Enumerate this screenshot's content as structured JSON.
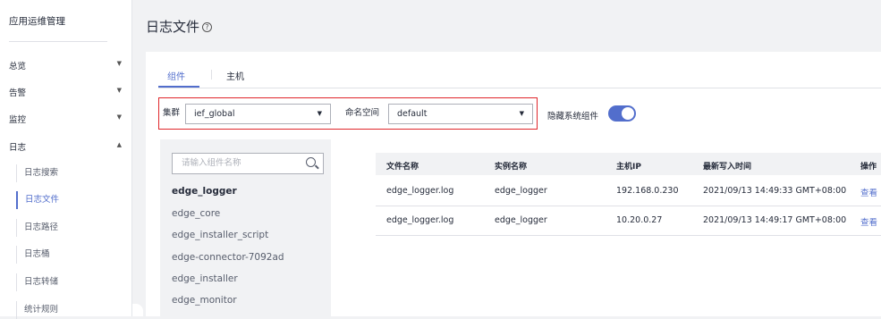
{
  "sidebar": {
    "title": "应用运维管理",
    "groups": [
      {
        "label": "总览",
        "arrow": "▼"
      },
      {
        "label": "告警",
        "arrow": "▼"
      },
      {
        "label": "监控",
        "arrow": "▼"
      },
      {
        "label": "日志",
        "arrow": "▲"
      }
    ],
    "sub_items": [
      {
        "label": "日志搜索",
        "active": false
      },
      {
        "label": "日志文件",
        "active": true
      },
      {
        "label": "日志路径",
        "active": false
      },
      {
        "label": "日志桶",
        "active": false
      },
      {
        "label": "日志转储",
        "active": false
      },
      {
        "label": "统计规则",
        "active": false
      }
    ]
  },
  "header": {
    "title": "日志文件",
    "help_icon": "question-circle-icon"
  },
  "tabs": [
    {
      "label": "组件",
      "active": true
    },
    {
      "label": "主机",
      "active": false
    }
  ],
  "filters": {
    "cluster_label": "集群",
    "cluster_value": "ief_global",
    "namespace_label": "命名空间",
    "namespace_value": "default",
    "hide_system_label": "隐藏系统组件",
    "hide_system_on": true
  },
  "components": {
    "search_placeholder": "请输入组件名称",
    "items": [
      "edge_logger",
      "edge_core",
      "edge_installer_script",
      "edge-connector-7092ad",
      "edge_installer",
      "edge_monitor"
    ],
    "selected": "edge_logger"
  },
  "table": {
    "columns": [
      "文件名称",
      "实例名称",
      "主机IP",
      "最新写入时间",
      "操作"
    ],
    "rows": [
      {
        "file": "edge_logger.log",
        "instance": "edge_logger",
        "ip": "192.168.0.230",
        "time": "2021/09/13 14:49:33 GMT+08:00",
        "action": "查看"
      },
      {
        "file": "edge_logger.log",
        "instance": "edge_logger",
        "ip": "10.20.0.27",
        "time": "2021/09/13 14:49:17 GMT+08:00",
        "action": "查看"
      }
    ]
  },
  "colors": {
    "accent": "#526ecc",
    "highlight_border": "#e0262b"
  }
}
